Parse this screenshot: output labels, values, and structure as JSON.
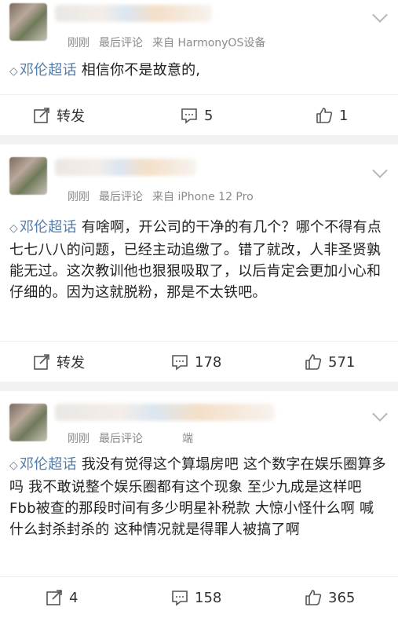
{
  "posts": [
    {
      "meta": {
        "time": "刚刚",
        "label": "最后评论",
        "source": "来自 HarmonyOS设备"
      },
      "topic": "邓伦超话",
      "text": "相信你不是故意的,",
      "actions": {
        "repost": "转发",
        "comments": "5",
        "likes": "1"
      }
    },
    {
      "meta": {
        "time": "刚刚",
        "label": "最后评论",
        "source": "来自 iPhone 12 Pro"
      },
      "topic": "邓伦超话",
      "text": "有啥啊，开公司的干净的有几个？哪个不得有点七七八八的问题，已经主动追缴了。错了就改，人非圣贤孰能无过。这次教训他也狠狠吸取了，以后肯定会更加小心和仔细的。因为这就脱粉，那是不太铁吧。",
      "actions": {
        "repost": "转发",
        "comments": "178",
        "likes": "571"
      }
    },
    {
      "meta": {
        "time": "刚刚",
        "label": "最后评论",
        "source": "端"
      },
      "topic": "邓伦超话",
      "text": "我没有觉得这个算塌房吧 这个数字在娱乐圈算多吗 我不敢说整个娱乐圈都有这个现象 至少九成是这样吧 Fbb被查的那段时间有多少明星补税款 大惊小怪什么啊 喊什么封杀封杀的 这种情况就是得罪人被搞了啊",
      "actions": {
        "repost": "4",
        "comments": "158",
        "likes": "365"
      }
    }
  ],
  "colors": {
    "topic": "#507daf",
    "meta": "#8a8a8a",
    "separator": "#f2f2f2"
  }
}
